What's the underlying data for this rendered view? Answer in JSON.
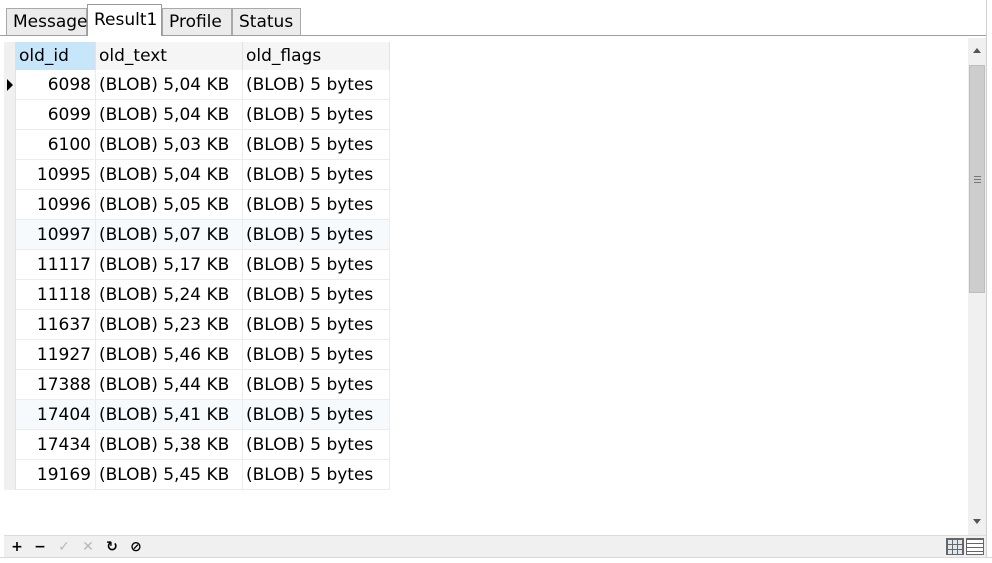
{
  "tabs": [
    {
      "label": "Message"
    },
    {
      "label": "Result1"
    },
    {
      "label": "Profile"
    },
    {
      "label": "Status"
    }
  ],
  "active_tab": "Result1",
  "columns": [
    "old_id",
    "old_text",
    "old_flags"
  ],
  "rows": [
    {
      "old_id": "6098",
      "old_text": "(BLOB) 5,04 KB",
      "old_flags": "(BLOB) 5 bytes"
    },
    {
      "old_id": "6099",
      "old_text": "(BLOB) 5,04 KB",
      "old_flags": "(BLOB) 5 bytes"
    },
    {
      "old_id": "6100",
      "old_text": "(BLOB) 5,03 KB",
      "old_flags": "(BLOB) 5 bytes"
    },
    {
      "old_id": "10995",
      "old_text": "(BLOB) 5,04 KB",
      "old_flags": "(BLOB) 5 bytes"
    },
    {
      "old_id": "10996",
      "old_text": "(BLOB) 5,05 KB",
      "old_flags": "(BLOB) 5 bytes"
    },
    {
      "old_id": "10997",
      "old_text": "(BLOB) 5,07 KB",
      "old_flags": "(BLOB) 5 bytes"
    },
    {
      "old_id": "11117",
      "old_text": "(BLOB) 5,17 KB",
      "old_flags": "(BLOB) 5 bytes"
    },
    {
      "old_id": "11118",
      "old_text": "(BLOB) 5,24 KB",
      "old_flags": "(BLOB) 5 bytes"
    },
    {
      "old_id": "11637",
      "old_text": "(BLOB) 5,23 KB",
      "old_flags": "(BLOB) 5 bytes"
    },
    {
      "old_id": "11927",
      "old_text": "(BLOB) 5,46 KB",
      "old_flags": "(BLOB) 5 bytes"
    },
    {
      "old_id": "17388",
      "old_text": "(BLOB) 5,44 KB",
      "old_flags": "(BLOB) 5 bytes"
    },
    {
      "old_id": "17404",
      "old_text": "(BLOB) 5,41 KB",
      "old_flags": "(BLOB) 5 bytes"
    },
    {
      "old_id": "17434",
      "old_text": "(BLOB) 5,38 KB",
      "old_flags": "(BLOB) 5 bytes"
    },
    {
      "old_id": "19169",
      "old_text": "(BLOB) 5,45 KB",
      "old_flags": "(BLOB) 5 bytes"
    }
  ],
  "toolbar": {
    "add_glyph": "+",
    "delete_glyph": "−",
    "save_glyph": "✓",
    "cancel_glyph": "✕",
    "refresh_glyph": "↻",
    "stop_glyph": "⊘",
    "icons": [
      "plus-icon",
      "minus-icon",
      "check-icon",
      "cross-icon",
      "refresh-icon",
      "stop-icon",
      "grid-view-icon",
      "form-view-icon"
    ]
  }
}
